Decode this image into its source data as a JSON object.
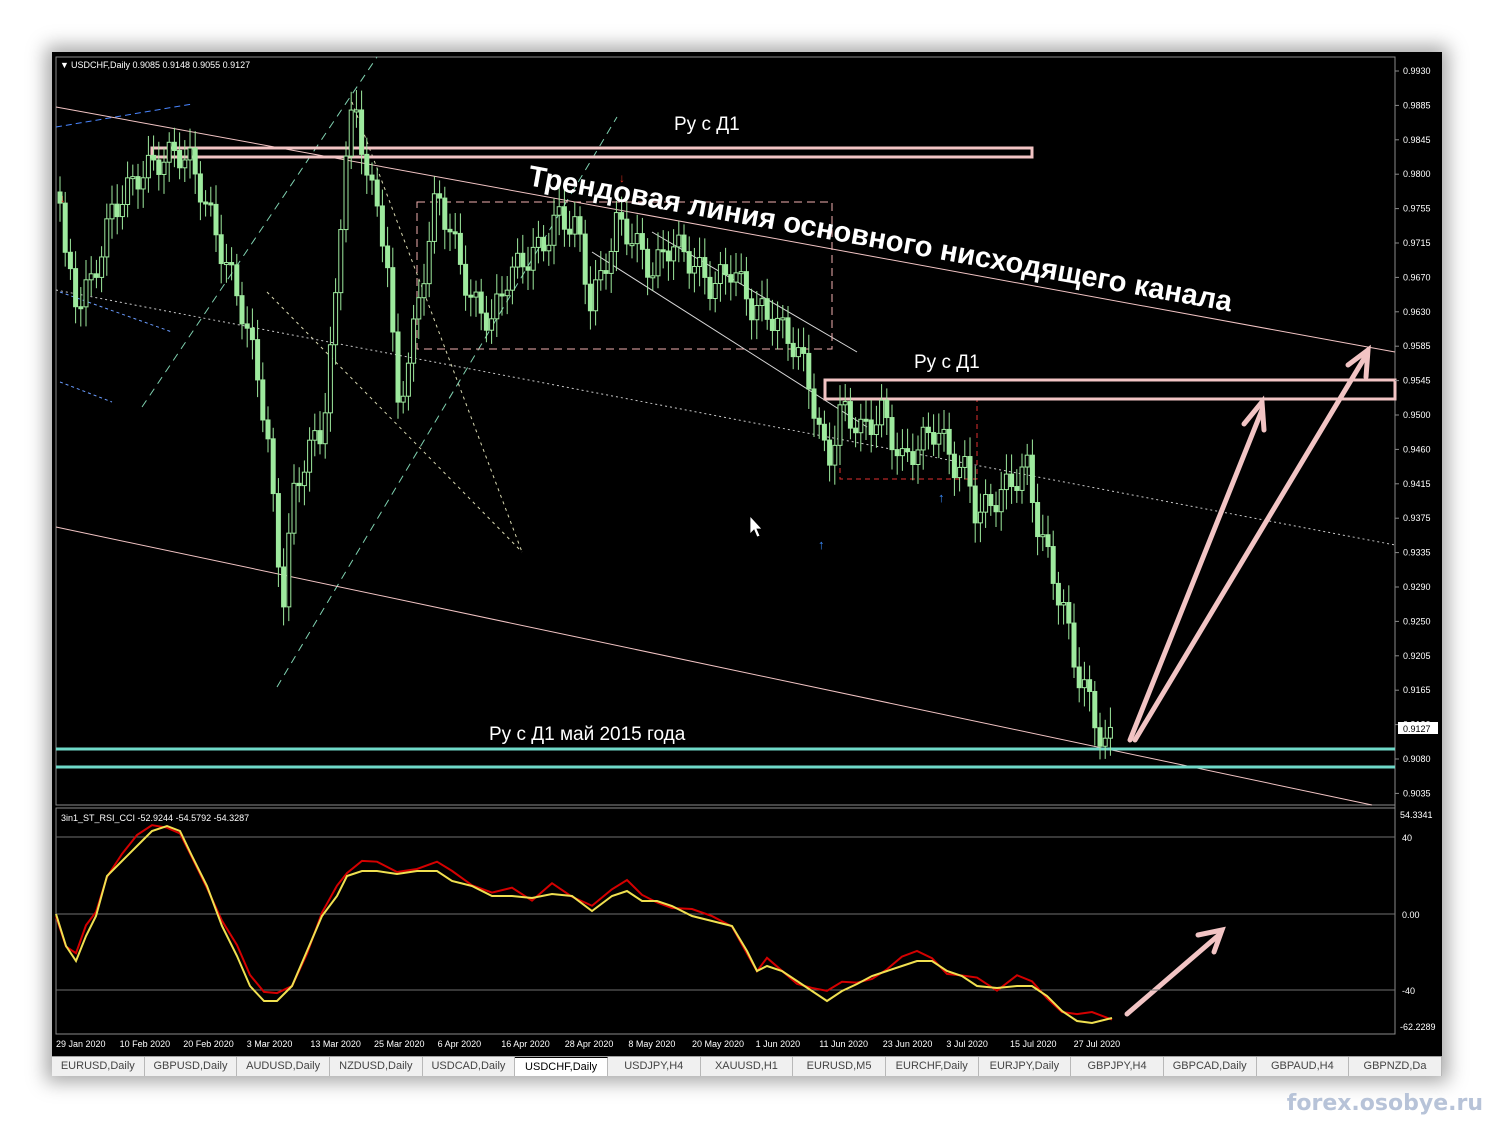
{
  "chart_header": "USDCHF,Daily  0.9085 0.9148 0.9055 0.9127",
  "indicator_header": "3in1_ST_RSI_CCI -52.9244 -54.5792 -54.3287",
  "annotations": {
    "resistance_top": "Ру с Д1",
    "resistance_mid": "Ру с Д1",
    "support_label": "Ру с Д1 май 2015 года",
    "trendline_label": "Трендовая линия основного нисходящего канала"
  },
  "price_axis": [
    "0.9930",
    "0.9885",
    "0.9845",
    "0.9800",
    "0.9755",
    "0.9715",
    "0.9670",
    "0.9630",
    "0.9585",
    "0.9545",
    "0.9500",
    "0.9460",
    "0.9415",
    "0.9375",
    "0.9335",
    "0.9290",
    "0.9250",
    "0.9205",
    "0.9165",
    "0.9120",
    "0.9080",
    "0.9035"
  ],
  "current_price": "0.9127",
  "indicator_axis": {
    "top": "54.3341",
    "l40": "40",
    "l0": "0.00",
    "lm40": "-40",
    "bottom": "-62.2289"
  },
  "date_axis": [
    "29 Jan 2020",
    "10 Feb 2020",
    "20 Feb 2020",
    "3 Mar 2020",
    "13 Mar 2020",
    "25 Mar 2020",
    "6 Apr 2020",
    "16 Apr 2020",
    "28 Apr 2020",
    "8 May 2020",
    "20 May 2020",
    "1 Jun 2020",
    "11 Jun 2020",
    "23 Jun 2020",
    "3 Jul 2020",
    "15 Jul 2020",
    "27 Jul 2020"
  ],
  "tabs": [
    "EURUSD,Daily",
    "GBPUSD,Daily",
    "AUDUSD,Daily",
    "NZDUSD,Daily",
    "USDCAD,Daily",
    "USDCHF,Daily",
    "USDJPY,H4",
    "XAUUSD,H1",
    "EURUSD,M5",
    "EURCHF,Daily",
    "EURJPY,Daily",
    "GBPJPY,H4",
    "GBPCAD,Daily",
    "GBPAUD,H4",
    "GBPNZD,Da"
  ],
  "active_tab": "USDCHF,Daily",
  "watermark": "forex.osobye.ru",
  "colors": {
    "candle": "#9eea9e",
    "support": "#6fd9c8",
    "resistance": "#f2c4c4",
    "indicator_fast": "#d40000",
    "indicator_slow": "#f0e050"
  }
}
